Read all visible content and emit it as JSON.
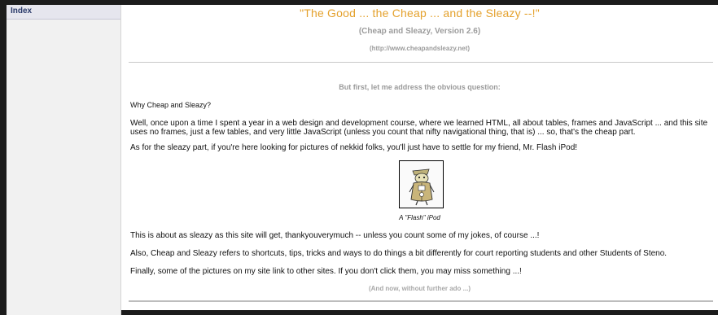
{
  "sidebar": {
    "index_label": "Index"
  },
  "header": {
    "title": "\"The Good ... the Cheap ... and the Sleazy --!\"",
    "subtitle": "(Cheap and Sleazy, Version 2.6)",
    "url": "(http://www.cheapandsleazy.net)"
  },
  "content": {
    "question_heading": "But first, let me address the obvious question:",
    "why": "Why Cheap and Sleazy?",
    "once": "Well, once upon a time I spent a year in a web design and development course, where we learned HTML, all about tables, frames and JavaScript ... and this site uses no frames, just a few tables, and very little JavaScript (unless you count that nifty navigational thing, that is) ... so, that's the cheap part.",
    "sleazy": "As for the sleazy part, if you're here looking for pictures of nekkid folks, you'll just have to settle for my friend, Mr. Flash iPod!",
    "image_icon": "flash-ipod-cartoon",
    "caption": "A \"Flash\" iPod",
    "this": "This is about as sleazy as this site will get, thankyouverymuch -- unless you count some of my jokes, of course ...!",
    "also": "Also, Cheap and Sleazy refers to shortcuts, tips, tricks and ways to do things a bit differently for court reporting students and other Students of Steno.",
    "final": "Finally, some of the pictures on my site link to other sites. If you don't click them, you may miss something ...!",
    "ado": "(And now, without further ado ...)"
  },
  "colors": {
    "title": "#e4a12c",
    "muted": "#9c9c9c",
    "background": "#1c1c1c"
  }
}
